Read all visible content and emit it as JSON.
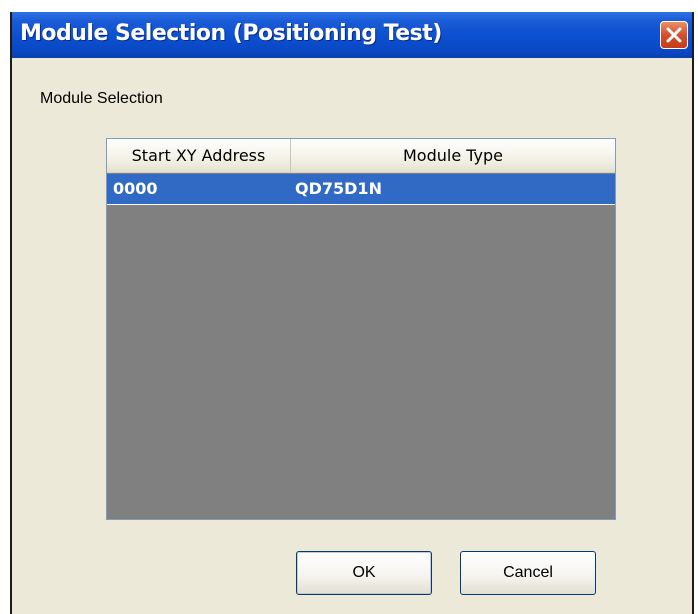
{
  "window": {
    "title": "Module Selection (Positioning Test)"
  },
  "titlebar": {
    "close_icon": "close-icon"
  },
  "section": {
    "label": "Module Selection"
  },
  "table": {
    "columns": [
      "Start XY Address",
      "Module Type"
    ],
    "rows": [
      {
        "start_xy_address": "0000",
        "module_type": "QD75D1N",
        "selected": true
      }
    ]
  },
  "buttons": {
    "ok_label": "OK",
    "cancel_label": "Cancel"
  },
  "colors": {
    "titlebar": "#0b4fd0",
    "selection": "#316ac5",
    "dialog_background": "#ece9d8",
    "list_background": "#808080",
    "close_button": "#d4502a"
  }
}
